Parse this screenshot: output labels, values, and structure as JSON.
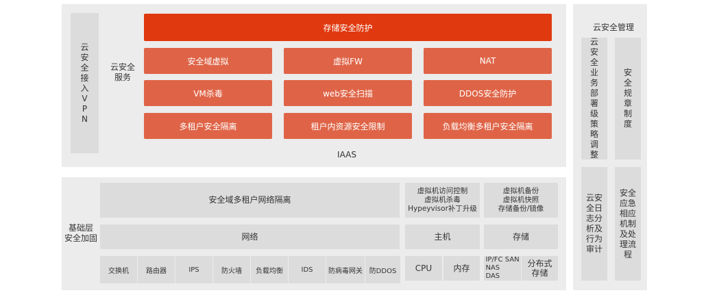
{
  "iaas": {
    "vpn": "云\n安\n全\n接\n入\nV\nP\nN",
    "service_label": "云安全\n服务",
    "top": "存储安全防护",
    "row1": [
      "安全域虚拟",
      "虚拟FW",
      "NAT"
    ],
    "row2": [
      "VM杀毒",
      "web安全扫描",
      "DDOS安全防护"
    ],
    "row3": [
      "多租户安全隔离",
      "租户内资源安全限制",
      "负载均衡多租户安全隔离"
    ],
    "caption": "IAAS"
  },
  "base": {
    "label": "基础层\n安全加固",
    "network_isolation": "安全域多租户网络隔离",
    "vm_security": "虚拟机访问控制\n虚拟机杀毒\nHypeyvisor补丁升级",
    "vm_backup": "虚拟机备份\n虚拟机快照\n存储备份/镜像",
    "network": "网络",
    "host": "主机",
    "storage": "存储",
    "network_items": [
      "交换机",
      "路由器",
      "IPS",
      "防火墙",
      "负载均衡",
      "IDS",
      "防病毒网关",
      "防DDOS"
    ],
    "host_items": [
      "CPU",
      "内存"
    ],
    "storage_types": "IP/FC SAN\nNAS\nDAS",
    "distributed_storage": "分布式\n存储"
  },
  "mgmt": {
    "title": "云安全管理",
    "col1_top": "云\n安\n全\n业\n务\n部\n署\n级\n策\n略\n调\n整",
    "col2_top": "安\n全\n规\n章\n制\n度",
    "col1_bottom": "云安\n全日\n志分\n析及\n行为\n审计",
    "col2_bottom": "安全\n应急\n相应\n机制\n及处\n理流\n程"
  }
}
